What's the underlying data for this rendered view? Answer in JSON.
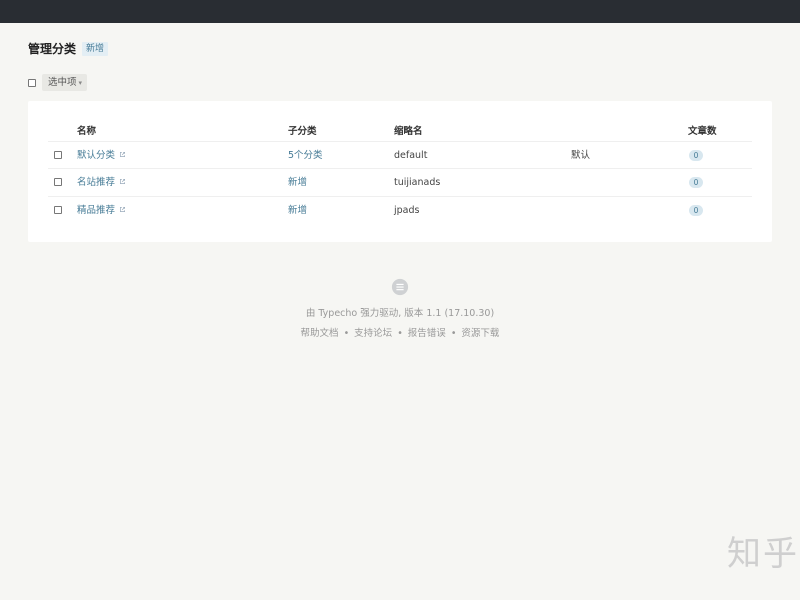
{
  "header": {
    "title": "管理分类",
    "add_label": "新增"
  },
  "toolbar": {
    "bulk_label": "选中项",
    "bulk_caret": "▾"
  },
  "table": {
    "columns": {
      "name": "名称",
      "sub": "子分类",
      "slug": "缩略名",
      "count": "文章数"
    },
    "rows": [
      {
        "name": "默认分类",
        "sub": "5个分类",
        "slug": "default",
        "default": "默认",
        "count": "0"
      },
      {
        "name": "名站推荐",
        "sub": "新增",
        "slug": "tuijianads",
        "default": "",
        "count": "0"
      },
      {
        "name": "精品推荐",
        "sub": "新增",
        "slug": "jpads",
        "default": "",
        "count": "0"
      }
    ]
  },
  "footer": {
    "powered_prefix": "由 ",
    "powered_name": "Typecho",
    "powered_suffix": " 强力驱动, 版本 1.1 (17.10.30)",
    "links": [
      "帮助文档",
      "支持论坛",
      "报告错误",
      "资源下载"
    ],
    "sep": "•"
  },
  "watermark": "知乎"
}
